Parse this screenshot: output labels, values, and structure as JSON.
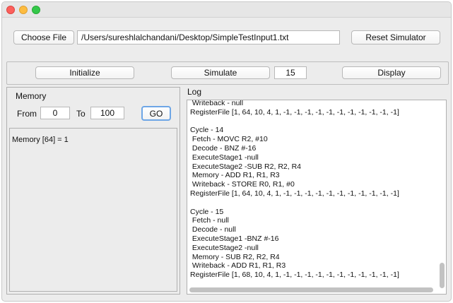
{
  "toolbar": {
    "choose_file_label": "Choose File",
    "file_path": "/Users/sureshlalchandani/Desktop/SimpleTestInput1.txt",
    "reset_label": "Reset Simulator"
  },
  "controls": {
    "initialize_label": "Initialize",
    "simulate_label": "Simulate",
    "cycles_value": "15",
    "display_label": "Display"
  },
  "memory": {
    "title": "Memory",
    "from_label": "From",
    "from_value": "0",
    "to_label": "To",
    "to_value": "100",
    "go_label": "GO",
    "output": "Memory [64] = 1"
  },
  "log": {
    "title": "Log",
    "lines": [
      " Writeback - null",
      "RegisterFile [1, 64, 10, 4, 1, -1, -1, -1, -1, -1, -1, -1, -1, -1, -1, -1]",
      "",
      "Cycle - 14",
      " Fetch - MOVC R2, #10",
      " Decode - BNZ #-16",
      " ExecuteStage1 -null",
      " ExecuteStage2 -SUB R2, R2, R4",
      " Memory - ADD R1, R1, R3",
      " Writeback - STORE R0, R1, #0",
      "RegisterFile [1, 64, 10, 4, 1, -1, -1, -1, -1, -1, -1, -1, -1, -1, -1, -1]",
      "",
      "Cycle - 15",
      " Fetch - null",
      " Decode - null",
      " ExecuteStage1 -BNZ #-16",
      " ExecuteStage2 -null",
      " Memory - SUB R2, R2, R4",
      " Writeback - ADD R1, R1, R3",
      "RegisterFile [1, 68, 10, 4, 1, -1, -1, -1, -1, -1, -1, -1, -1, -1, -1, -1]"
    ]
  }
}
